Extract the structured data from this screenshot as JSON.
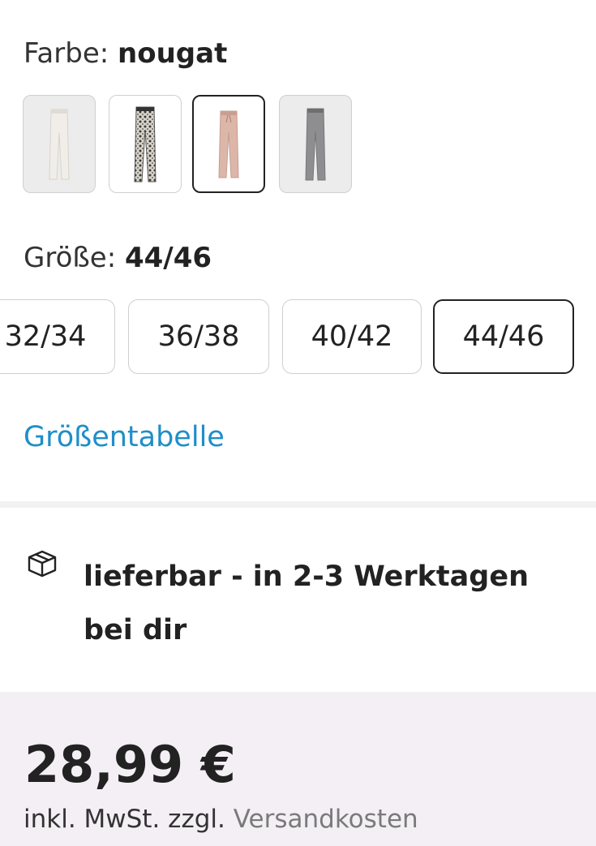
{
  "color": {
    "label": "Farbe:",
    "selected_value": "nougat",
    "swatches": [
      {
        "name": "ecru",
        "color": "#e9e4de",
        "bg": "grey"
      },
      {
        "name": "leopard",
        "color": "#8a8a84",
        "bg": "white"
      },
      {
        "name": "nougat",
        "color": "#d9b3a5",
        "bg": "white",
        "selected": true
      },
      {
        "name": "grau",
        "color": "#8e8e90",
        "bg": "grey"
      }
    ]
  },
  "size": {
    "label": "Größe:",
    "selected_value": "44/46",
    "options": [
      "32/34",
      "36/38",
      "40/42",
      "44/46"
    ],
    "size_table_link": "Größentabelle"
  },
  "delivery": {
    "icon": "package-box-icon",
    "text": "lieferbar - in 2-3 Werktagen bei dir"
  },
  "pricing": {
    "price": "28,99 €",
    "tax_note_prefix": "inkl. MwSt. zzgl.",
    "shipping_link": "Versandkosten"
  }
}
